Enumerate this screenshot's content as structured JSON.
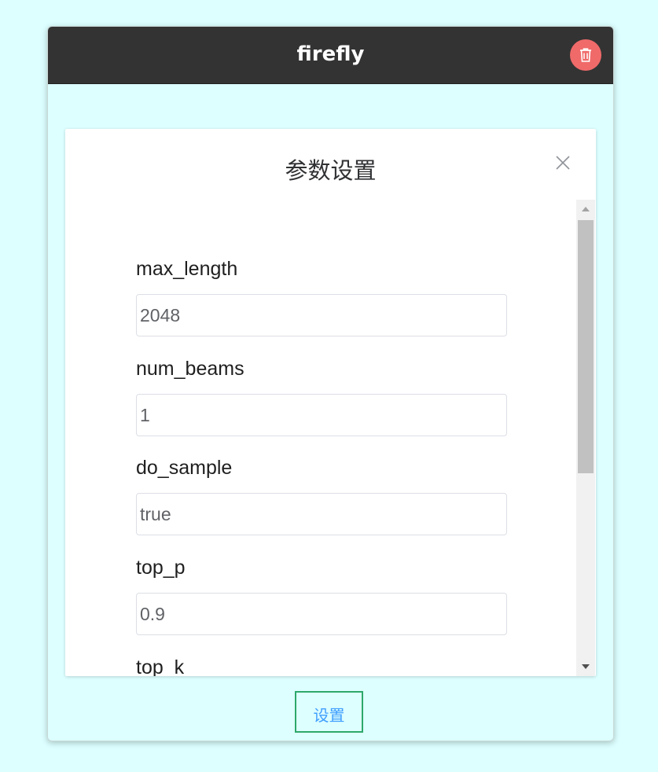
{
  "header": {
    "title": "firefly",
    "trash_icon": "trash-icon",
    "trash_color": "#f06a6a"
  },
  "dialog": {
    "title": "参数设置",
    "close_icon": "close-icon",
    "fields": [
      {
        "label": "max_length",
        "value": "2048"
      },
      {
        "label": "num_beams",
        "value": "1"
      },
      {
        "label": "do_sample",
        "value": "true"
      },
      {
        "label": "top_p",
        "value": "0.9"
      },
      {
        "label": "top_k",
        "value": ""
      }
    ]
  },
  "footer": {
    "set_button_label": "设置",
    "set_button_color": "#409eff",
    "set_button_border": "#2ea86a"
  }
}
